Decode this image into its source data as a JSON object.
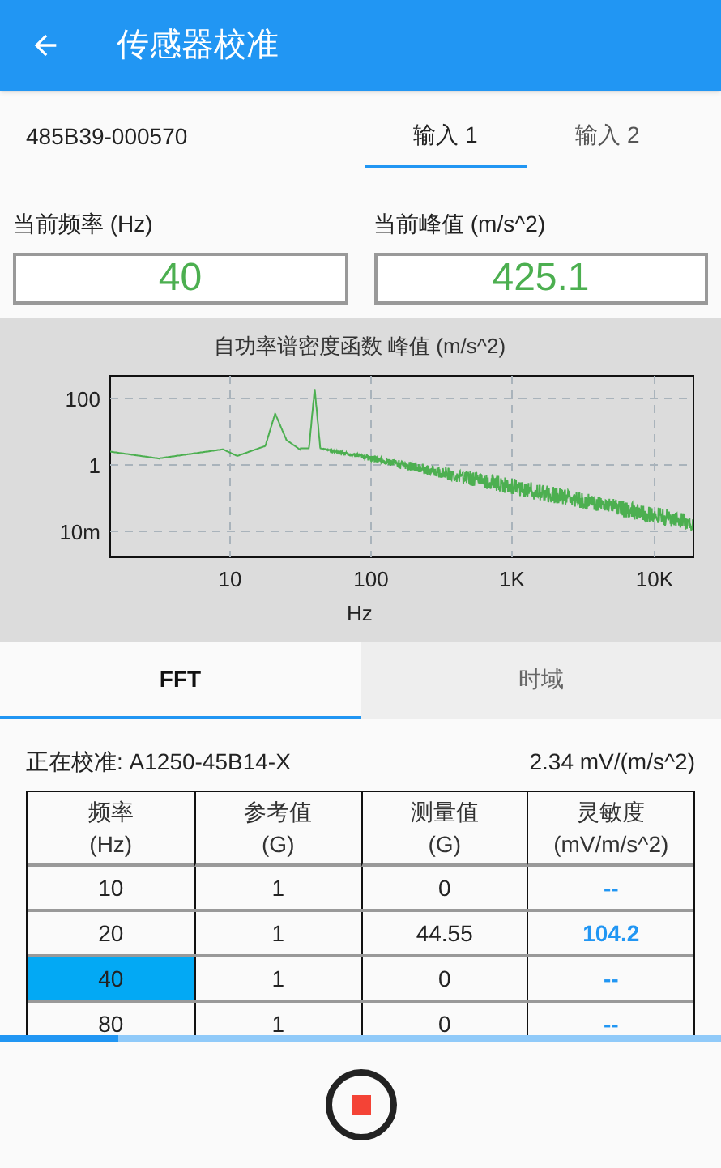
{
  "app_bar": {
    "title": "传感器校准"
  },
  "device": {
    "serial": "485B39-000570"
  },
  "input_tabs": [
    {
      "label": "输入 1",
      "selected": true
    },
    {
      "label": "输入 2",
      "selected": false
    }
  ],
  "readouts": [
    {
      "label": "当前频率 (Hz)",
      "value": "40"
    },
    {
      "label": "当前峰值 (m/s^2)",
      "value": "425.1"
    }
  ],
  "spectrum": {
    "title": "自功率谱密度函数 峰值 (m/s^2)",
    "xlabel": "Hz",
    "xticks": [
      "10",
      "100",
      "1K",
      "10K"
    ],
    "yticks": [
      "100",
      "1",
      "10m"
    ]
  },
  "view_tabs": [
    {
      "label": "FFT",
      "selected": true
    },
    {
      "label": "时域",
      "selected": false
    }
  ],
  "calibration": {
    "sensor": "正在校准: A1250-45B14-X",
    "sensitivity": "2.34 mV/(m/s^2)"
  },
  "table": {
    "columns": [
      "频率\n(Hz)",
      "参考值\n(G)",
      "测量值\n(G)",
      "灵敏度\n(mV/m/s^2)"
    ],
    "rows": [
      {
        "cells": [
          "10",
          "1",
          "0",
          "--"
        ],
        "selected": false
      },
      {
        "cells": [
          "20",
          "1",
          "44.55",
          "104.2"
        ],
        "selected": false
      },
      {
        "cells": [
          "40",
          "1",
          "0",
          "--"
        ],
        "selected": true
      },
      {
        "cells": [
          "80",
          "1",
          "0",
          "--"
        ],
        "selected": false
      }
    ]
  },
  "progress": {
    "level": 0.165
  }
}
